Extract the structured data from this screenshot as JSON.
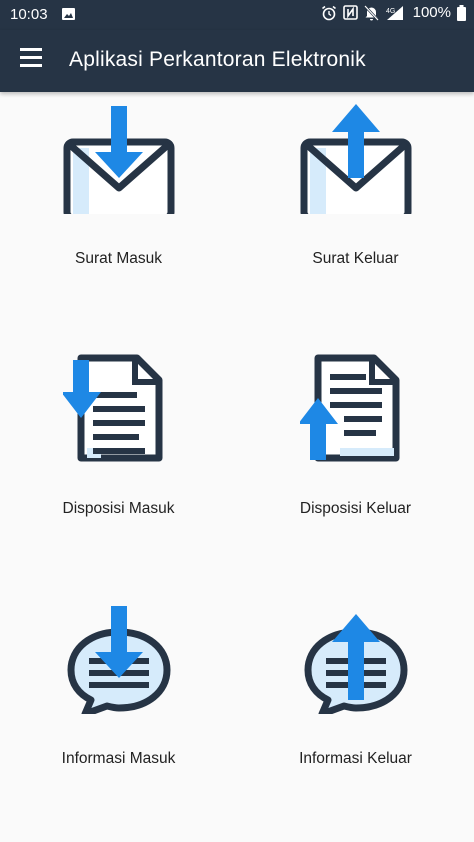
{
  "status_bar": {
    "time": "10:03",
    "battery": "100%",
    "network_label": "4G",
    "icons": [
      "image-icon",
      "alarm-icon",
      "nfc-icon",
      "mute-icon",
      "signal-icon",
      "battery-icon"
    ]
  },
  "app_bar": {
    "title": "Aplikasi Perkantoran Elektronik",
    "menu_icon": "hamburger-menu-icon"
  },
  "menu": [
    {
      "label": "Surat Masuk",
      "icon": "mail-inbox-icon"
    },
    {
      "label": "Surat Keluar",
      "icon": "mail-outbox-icon"
    },
    {
      "label": "Disposisi Masuk",
      "icon": "document-incoming-icon"
    },
    {
      "label": "Disposisi Keluar",
      "icon": "document-outgoing-icon"
    },
    {
      "label": "Informasi Masuk",
      "icon": "chat-incoming-icon"
    },
    {
      "label": "Informasi Keluar",
      "icon": "chat-outgoing-icon"
    }
  ],
  "colors": {
    "app_bar": "#263445",
    "icon_dark": "#263445",
    "icon_blue": "#1e88e5",
    "icon_light_blue": "#d6ebfb",
    "background": "#fafafa"
  }
}
